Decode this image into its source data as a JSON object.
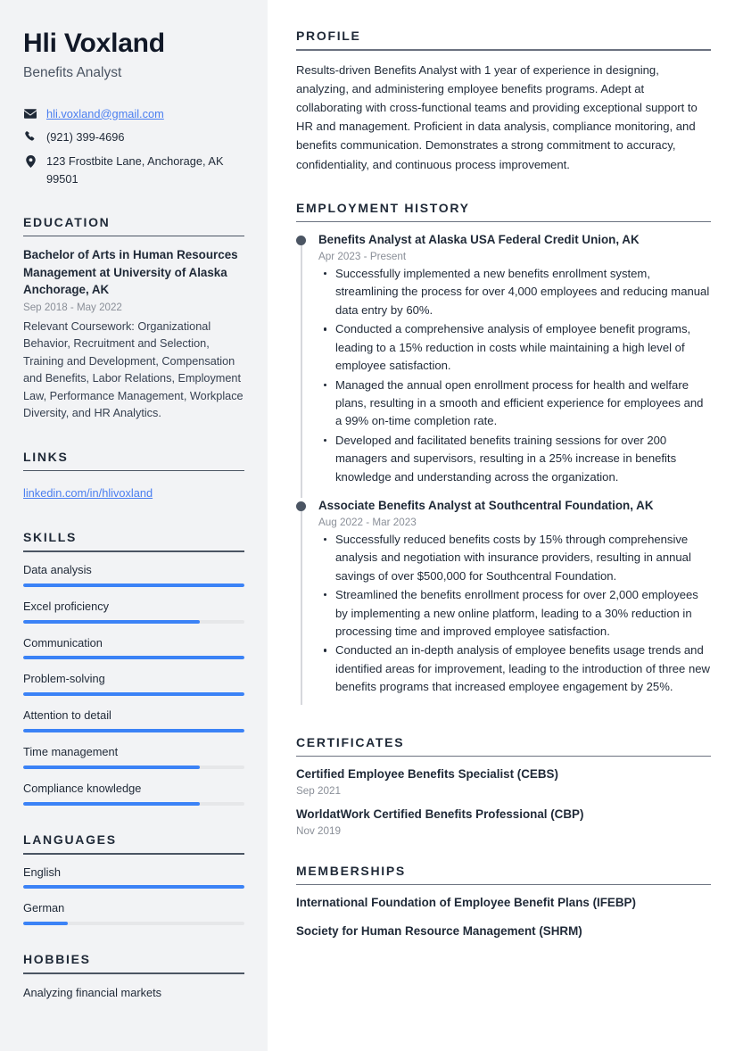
{
  "sidebar": {
    "name": "Hli Voxland",
    "job_title": "Benefits Analyst",
    "contacts": [
      {
        "icon": "envelope-icon",
        "text": "hli.voxland@gmail.com",
        "is_link": true
      },
      {
        "icon": "phone-icon",
        "text": "(921) 399-4696",
        "is_link": false
      },
      {
        "icon": "map-pin-icon",
        "text": "123 Frostbite Lane, Anchorage, AK 99501",
        "is_link": false
      }
    ],
    "education": {
      "heading": "EDUCATION",
      "items": [
        {
          "title": "Bachelor of Arts in Human Resources Management at University of Alaska Anchorage, AK",
          "date": "Sep 2018 - May 2022",
          "description": "Relevant Coursework: Organizational Behavior, Recruitment and Selection, Training and Development, Compensation and Benefits, Labor Relations, Employment Law, Performance Management, Workplace Diversity, and HR Analytics."
        }
      ]
    },
    "links": {
      "heading": "LINKS",
      "items": [
        {
          "label": "linkedin.com/in/hlivoxland"
        }
      ]
    },
    "skills": {
      "heading": "SKILLS",
      "items": [
        {
          "label": "Data analysis",
          "level": 100
        },
        {
          "label": "Excel proficiency",
          "level": 80
        },
        {
          "label": "Communication",
          "level": 100
        },
        {
          "label": "Problem-solving",
          "level": 100
        },
        {
          "label": "Attention to detail",
          "level": 100
        },
        {
          "label": "Time management",
          "level": 80
        },
        {
          "label": "Compliance knowledge",
          "level": 80
        }
      ]
    },
    "languages": {
      "heading": "LANGUAGES",
      "items": [
        {
          "label": "English",
          "level": 100
        },
        {
          "label": "German",
          "level": 20
        }
      ]
    },
    "hobbies": {
      "heading": "HOBBIES",
      "items": [
        {
          "label": "Analyzing financial markets"
        }
      ]
    }
  },
  "main": {
    "profile": {
      "heading": "PROFILE",
      "text": "Results-driven Benefits Analyst with 1 year of experience in designing, analyzing, and administering employee benefits programs. Adept at collaborating with cross-functional teams and providing exceptional support to HR and management. Proficient in data analysis, compliance monitoring, and benefits communication. Demonstrates a strong commitment to accuracy, confidentiality, and continuous process improvement."
    },
    "employment": {
      "heading": "EMPLOYMENT HISTORY",
      "jobs": [
        {
          "title": "Benefits Analyst at Alaska USA Federal Credit Union, AK",
          "date": "Apr 2023 - Present",
          "bullets": [
            "Successfully implemented a new benefits enrollment system, streamlining the process for over 4,000 employees and reducing manual data entry by 60%.",
            "Conducted a comprehensive analysis of employee benefit programs, leading to a 15% reduction in costs while maintaining a high level of employee satisfaction.",
            "Managed the annual open enrollment process for health and welfare plans, resulting in a smooth and efficient experience for employees and a 99% on-time completion rate.",
            "Developed and facilitated benefits training sessions for over 200 managers and supervisors, resulting in a 25% increase in benefits knowledge and understanding across the organization."
          ]
        },
        {
          "title": "Associate Benefits Analyst at Southcentral Foundation, AK",
          "date": "Aug 2022 - Mar 2023",
          "bullets": [
            "Successfully reduced benefits costs by 15% through comprehensive analysis and negotiation with insurance providers, resulting in annual savings of over $500,000 for Southcentral Foundation.",
            "Streamlined the benefits enrollment process for over 2,000 employees by implementing a new online platform, leading to a 30% reduction in processing time and improved employee satisfaction.",
            "Conducted an in-depth analysis of employee benefits usage trends and identified areas for improvement, leading to the introduction of three new benefits programs that increased employee engagement by 25%."
          ]
        }
      ]
    },
    "certificates": {
      "heading": "CERTIFICATES",
      "items": [
        {
          "title": "Certified Employee Benefits Specialist (CEBS)",
          "date": "Sep 2021"
        },
        {
          "title": "WorldatWork Certified Benefits Professional (CBP)",
          "date": "Nov 2019"
        }
      ]
    },
    "memberships": {
      "heading": "MEMBERSHIPS",
      "items": [
        {
          "title": "International Foundation of Employee Benefit Plans (IFEBP)"
        },
        {
          "title": "Society for Human Resource Management (SHRM)"
        }
      ]
    }
  },
  "colors": {
    "sidebar_bg": "#f2f3f5",
    "accent_bar": "#3b82f6",
    "link": "#4a7ef0",
    "heading": "#1f2937",
    "muted": "#8a8f98"
  }
}
